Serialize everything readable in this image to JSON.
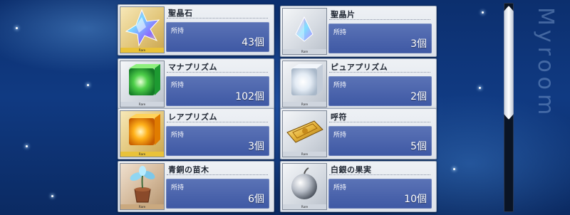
{
  "items": [
    {
      "name": "聖晶石",
      "held_label": "所持",
      "count": "43個",
      "rarity": "Rare"
    },
    {
      "name": "聖晶片",
      "held_label": "所持",
      "count": "3個",
      "rarity": "Rare"
    },
    {
      "name": "マナプリズム",
      "held_label": "所持",
      "count": "102個",
      "rarity": "Rare"
    },
    {
      "name": "ピュアプリズム",
      "held_label": "所持",
      "count": "2個",
      "rarity": "Rare"
    },
    {
      "name": "レアプリズム",
      "held_label": "所持",
      "count": "3個",
      "rarity": "Rare"
    },
    {
      "name": "呼符",
      "held_label": "所持",
      "count": "5個",
      "rarity": "Rare"
    },
    {
      "name": "青銅の苗木",
      "held_label": "所持",
      "count": "6個",
      "rarity": "Rare"
    },
    {
      "name": "白銀の果実",
      "held_label": "所持",
      "count": "10個",
      "rarity": "Rare"
    }
  ],
  "icons": [
    "saint-quartz-icon",
    "quartz-fragment-icon",
    "mana-prism-icon",
    "pure-prism-icon",
    "rare-prism-icon",
    "summon-ticket-icon",
    "bronze-sapling-icon",
    "silver-fruit-icon"
  ],
  "watermark": "Myroom",
  "scroll": {
    "position": 0.0
  },
  "colors": {
    "gold_frame": "#e9c23a",
    "silver_frame": "#cfd5de",
    "bronze_frame": "#caa97f",
    "qty_panel": "#4a63ad"
  }
}
